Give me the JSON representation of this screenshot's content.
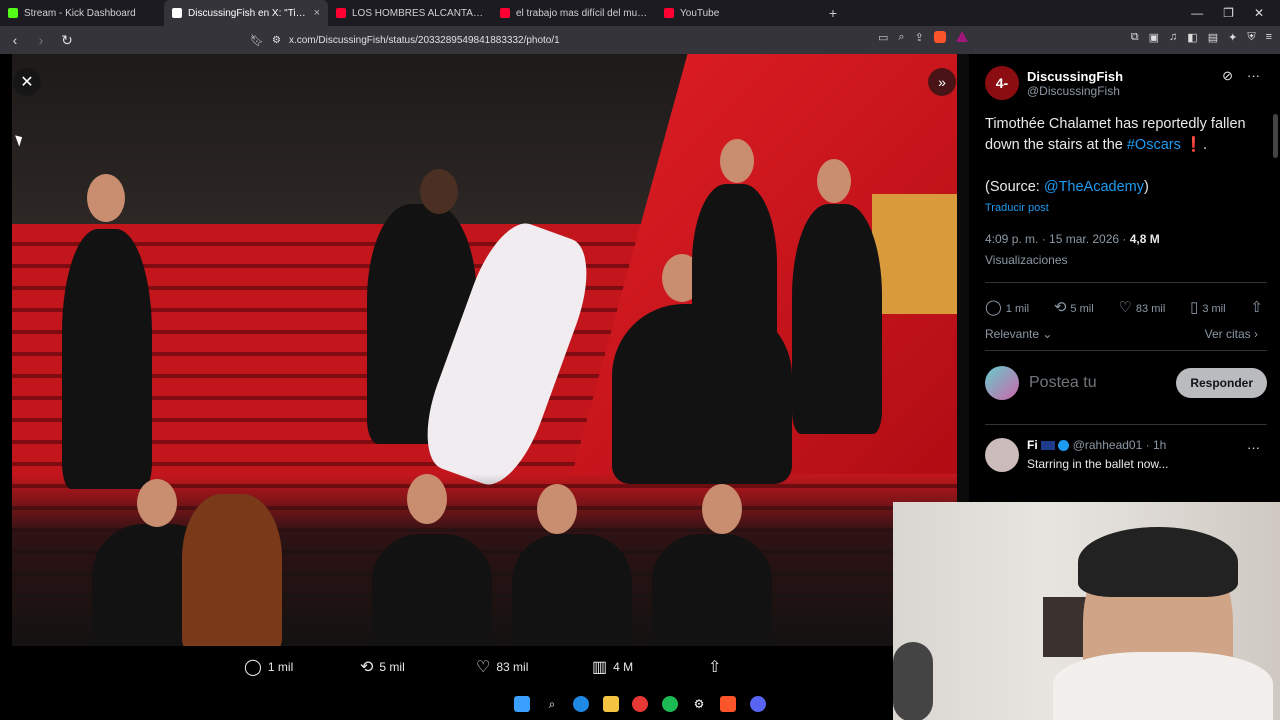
{
  "tabs": [
    {
      "title": "Stream - Kick Dashboard",
      "color": "#53fc18"
    },
    {
      "title": "DiscussingFish en X: \"Timothée",
      "color": "#ffffff",
      "active": true
    },
    {
      "title": "LOS HOMBRES ALCANTARILLA: el tra",
      "color": "#ff0033"
    },
    {
      "title": "el trabajo mas difícil del mundo - You",
      "color": "#ff0033"
    },
    {
      "title": "YouTube",
      "color": "#ff0033"
    }
  ],
  "tab_close_glyph": "×",
  "newtab_glyph": "+",
  "url": "x.com/DiscussingFish/status/2033289549841883332/photo/1",
  "photo": {
    "actions": {
      "replies": "1 mil",
      "reposts": "5 mil",
      "likes": "83 mil",
      "views": "4 M"
    }
  },
  "post": {
    "author_name": "DiscussingFish",
    "author_handle": "@DiscussingFish",
    "text_line1": "Timothée Chalamet has reportedly fallen down the stairs at the ",
    "hashtag": "#Oscars",
    "text_end": " ❗.",
    "source_prefix": "(Source: ",
    "source_handle": "@TheAcademy",
    "source_suffix": ")",
    "translate": "Traducir post",
    "time": "4:09 p. m. · 15 mar. 2026 · ",
    "views_count": "4,8 M",
    "views_label": "Visualizaciones",
    "stats": {
      "replies": "1 mil",
      "reposts": "5 mil",
      "likes": "83 mil",
      "bookmarks": "3 mil"
    },
    "sort_label": "Relevante",
    "quotes_label": "Ver citas",
    "reply_placeholder": "Postea tu",
    "reply_button": "Responder"
  },
  "comment": {
    "name": "Fi",
    "handle": "@rahhead01",
    "time": "· 1h",
    "text": "Starring in the ballet now..."
  }
}
